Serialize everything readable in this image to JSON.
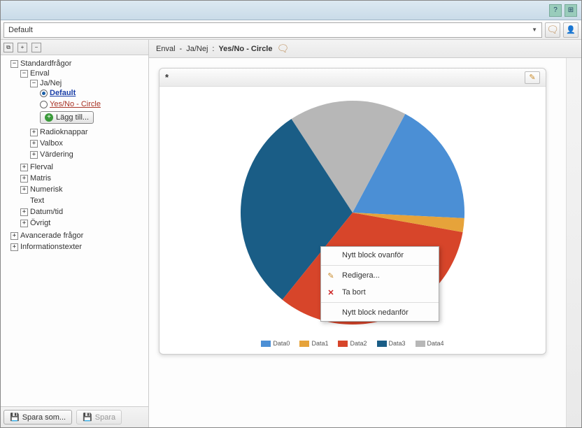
{
  "titlebar": {
    "help": "?",
    "tool": "⊞"
  },
  "topbar": {
    "dropdown_value": "Default"
  },
  "sidebar": {
    "root": "Standardfrågor",
    "enval": "Enval",
    "janej": "Ja/Nej",
    "opt_default": "Default",
    "opt_yesno": "Yes/No - Circle",
    "add": "Lägg till...",
    "radioknappar": "Radioknappar",
    "valbox": "Valbox",
    "vardering": "Värdering",
    "flerval": "Flerval",
    "matris": "Matris",
    "numerisk": "Numerisk",
    "text": "Text",
    "datumtid": "Datum/tid",
    "ovrigt": "Övrigt",
    "adv": "Avancerade frågor",
    "info": "Informationstexter",
    "save_as": "Spara som...",
    "save": "Spara"
  },
  "crumb": {
    "a": "Enval",
    "b": "Ja/Nej",
    "c": "Yes/No - Circle"
  },
  "card": {
    "marker": "*"
  },
  "chart_data": {
    "type": "pie",
    "title": "",
    "series": [
      {
        "name": "Data0",
        "value": 18,
        "color": "#4b8fd5"
      },
      {
        "name": "Data1",
        "value": 2,
        "color": "#e6a33a"
      },
      {
        "name": "Data2",
        "value": 33,
        "color": "#d7452a"
      },
      {
        "name": "Data3",
        "value": 30,
        "color": "#1a5d86"
      },
      {
        "name": "Data4",
        "value": 17,
        "color": "#b7b7b7"
      }
    ]
  },
  "contextmenu": {
    "above": "Nytt block ovanför",
    "edit": "Redigera...",
    "delete": "Ta bort",
    "below": "Nytt block nedanför"
  }
}
